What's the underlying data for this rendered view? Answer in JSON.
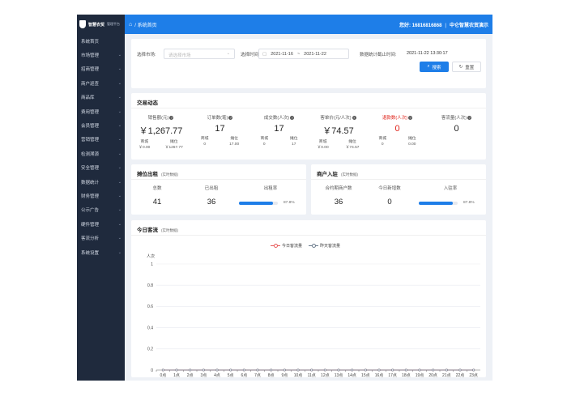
{
  "app": {
    "brand": "智慧农贸",
    "brand_sub": "管理平台"
  },
  "sidebar": {
    "items": [
      {
        "label": "系统首页",
        "chevron": false
      },
      {
        "label": "市场管理",
        "chevron": true
      },
      {
        "label": "招商管理",
        "chevron": true
      },
      {
        "label": "商户巡查",
        "chevron": true
      },
      {
        "label": "商品库",
        "chevron": true
      },
      {
        "label": "费用管理",
        "chevron": true
      },
      {
        "label": "会员管理",
        "chevron": true
      },
      {
        "label": "营销管理",
        "chevron": true
      },
      {
        "label": "检测溯源",
        "chevron": true
      },
      {
        "label": "安全管理",
        "chevron": true
      },
      {
        "label": "数据统计",
        "chevron": true
      },
      {
        "label": "财务管理",
        "chevron": true
      },
      {
        "label": "公示广告",
        "chevron": true
      },
      {
        "label": "硬件管理",
        "chevron": true
      },
      {
        "label": "客流分析",
        "chevron": true
      },
      {
        "label": "系统设置",
        "chevron": true
      }
    ]
  },
  "header": {
    "breadcrumb": "/ 系统首页",
    "greeting": "您好: 16816816868",
    "market": "中仑智慧农贸演示"
  },
  "filter": {
    "market_label": "选择市场:",
    "market_placeholder": "请选择市场",
    "time_label": "选择时间:",
    "date_start": "2021-11-16",
    "date_sep": "~",
    "date_end": "2021-11-22",
    "deadline_label": "数据统计截止时间:",
    "deadline_value": "2021-11-22 13:30:17",
    "search_label": "搜索",
    "reset_label": "重置"
  },
  "trade": {
    "title": "交易动态",
    "stats": [
      {
        "label": "销售额(元)",
        "value": "￥1,267.77",
        "red": false,
        "sub": [
          {
            "k": "商城",
            "v": "￥0.00"
          },
          {
            "k": "摊位",
            "v": "￥1267.77"
          }
        ]
      },
      {
        "label": "订单数(笔)",
        "value": "17",
        "red": false,
        "sub": [
          {
            "k": "商城",
            "v": "0"
          },
          {
            "k": "摊位",
            "v": "17.00"
          }
        ]
      },
      {
        "label": "成交数(人次)",
        "value": "17",
        "red": false,
        "sub": [
          {
            "k": "商城",
            "v": "0"
          },
          {
            "k": "摊位",
            "v": "17"
          }
        ]
      },
      {
        "label": "客单价(元/人次)",
        "value": "￥74.57",
        "red": false,
        "sub": [
          {
            "k": "商城",
            "v": "￥0.00"
          },
          {
            "k": "摊位",
            "v": "￥74.57"
          }
        ]
      },
      {
        "label": "退款数(人次)",
        "value": "0",
        "red": true,
        "sub": [
          {
            "k": "商城",
            "v": "0"
          },
          {
            "k": "摊位",
            "v": "0.00"
          }
        ]
      },
      {
        "label": "客流量(人次)",
        "value": "0",
        "red": false,
        "sub": []
      }
    ]
  },
  "booth": {
    "title": "摊位出租",
    "note": "(实时数据)",
    "total_label": "总数",
    "total_value": "41",
    "rented_label": "已出租",
    "rented_value": "36",
    "rate_label": "出租率",
    "rate_value": 87.8,
    "rate_text": "87.8%"
  },
  "merchant": {
    "title": "商户入驻",
    "note": "(实时数据)",
    "contract_label": "合约期商户数",
    "contract_value": "36",
    "new_label": "今日新增数",
    "new_value": "0",
    "rate_label": "入驻率",
    "rate_value": 87.8,
    "rate_text": "87.8%"
  },
  "traffic": {
    "title": "今日客流",
    "note": "(实时数据)"
  },
  "colors": {
    "primary": "#1e7ee8",
    "sidebar_bg": "#1f2a3d",
    "today_series": "#e85a5a",
    "yesterday_series": "#6a7a8c"
  },
  "chart_data": {
    "type": "line",
    "title": "",
    "xlabel": "",
    "ylabel": "人次",
    "ylim": [
      0,
      1
    ],
    "yticks": [
      "0",
      "0.2",
      "0.4",
      "0.6",
      "0.8",
      "1"
    ],
    "legend_position": "top-center",
    "categories": [
      "0点",
      "1点",
      "2点",
      "3点",
      "4点",
      "5点",
      "6点",
      "7点",
      "8点",
      "9点",
      "10点",
      "11点",
      "12点",
      "13点",
      "14点",
      "15点",
      "16点",
      "17点",
      "18点",
      "19点",
      "20点",
      "21点",
      "22点",
      "23点"
    ],
    "series": [
      {
        "name": "今日客流量",
        "values": [
          0,
          0,
          0,
          0,
          0,
          0,
          0,
          0,
          0,
          0,
          0,
          0,
          0,
          0,
          0,
          0,
          0,
          0,
          0,
          0,
          0,
          0,
          0,
          0
        ]
      },
      {
        "name": "昨天客流量",
        "values": [
          0,
          0,
          0,
          0,
          0,
          0,
          0,
          0,
          0,
          0,
          0,
          0,
          0,
          0,
          0,
          0,
          0,
          0,
          0,
          0,
          0,
          0,
          0,
          0
        ]
      }
    ]
  }
}
